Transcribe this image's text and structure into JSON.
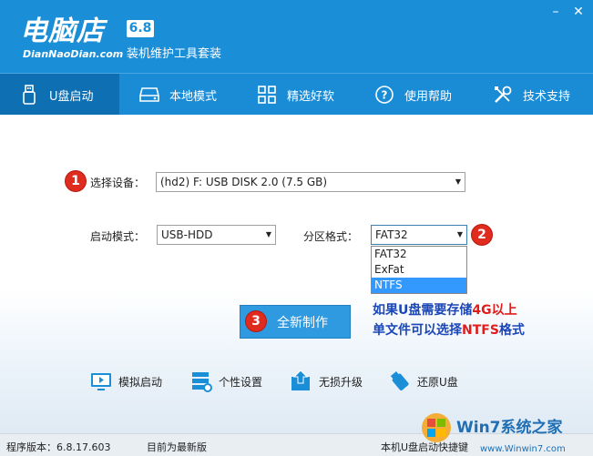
{
  "app": {
    "logo_main": "电脑店",
    "logo_sub": "DianNaoDian.com",
    "version_badge": "6.8",
    "tagline": "装机维护工具套装"
  },
  "window_controls": {
    "minimize": "–",
    "close": "✕"
  },
  "nav": [
    {
      "label": "U盘启动",
      "icon": "usb-drive-icon"
    },
    {
      "label": "本地模式",
      "icon": "hard-disk-icon"
    },
    {
      "label": "精选好软",
      "icon": "grid-apps-icon"
    },
    {
      "label": "使用帮助",
      "icon": "help-icon"
    },
    {
      "label": "技术支持",
      "icon": "tools-icon"
    }
  ],
  "form": {
    "step1_num": "1",
    "device_label": "选择设备：",
    "device_value": "(hd2) F: USB DISK 2.0 (7.5 GB)",
    "boot_mode_label": "启动模式：",
    "boot_mode_value": "USB-HDD",
    "partition_label": "分区格式：",
    "partition_value": "FAT32",
    "step2_num": "2",
    "partition_options": [
      "FAT32",
      "ExFat",
      "NTFS"
    ],
    "selected_option": "NTFS",
    "step3_num": "3",
    "create_button": "全新制作"
  },
  "note": {
    "line1_pre": "如果U盘需要存储",
    "line1_red": "4G以上",
    "line2_pre": "单文件可以选择",
    "line2_red": "NTFS",
    "line2_post": "格式"
  },
  "tools": [
    {
      "label": "模拟启动",
      "icon": "monitor-icon"
    },
    {
      "label": "个性设置",
      "icon": "server-settings-icon"
    },
    {
      "label": "无损升级",
      "icon": "upgrade-icon"
    },
    {
      "label": "还原U盘",
      "icon": "usb-restore-icon"
    }
  ],
  "footer": {
    "version": "程序版本：6.8.17.603",
    "status": "目前为最新版",
    "right_text": "本机U盘启动快捷键"
  },
  "watermark": {
    "text": "Win7系统之家",
    "url_text": "www.Winwin7.com"
  },
  "colors": {
    "brand_blue": "#1b8ed8",
    "badge_red": "#e02b1f",
    "note_blue": "#1a46b8"
  }
}
